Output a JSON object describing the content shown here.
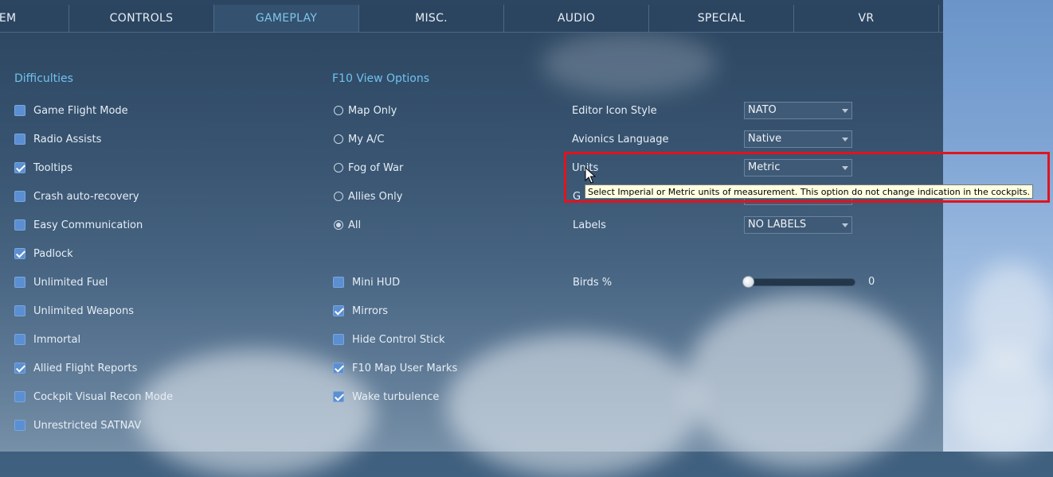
{
  "tabs": [
    {
      "label": "TEM"
    },
    {
      "label": "CONTROLS"
    },
    {
      "label": "GAMEPLAY"
    },
    {
      "label": "MISC."
    },
    {
      "label": "AUDIO"
    },
    {
      "label": "SPECIAL"
    },
    {
      "label": "VR"
    }
  ],
  "difficulties": {
    "title": "Difficulties",
    "items": [
      {
        "label": "Game Flight Mode",
        "checked": false
      },
      {
        "label": "Radio Assists",
        "checked": false
      },
      {
        "label": "Tooltips",
        "checked": true
      },
      {
        "label": "Crash auto-recovery",
        "checked": false
      },
      {
        "label": "Easy Communication",
        "checked": false
      },
      {
        "label": "Padlock",
        "checked": true
      },
      {
        "label": "Unlimited Fuel",
        "checked": false
      },
      {
        "label": "Unlimited Weapons",
        "checked": false
      },
      {
        "label": "Immortal",
        "checked": false
      },
      {
        "label": "Allied Flight Reports",
        "checked": true
      },
      {
        "label": "Cockpit Visual Recon Mode",
        "checked": false
      },
      {
        "label": "Unrestricted SATNAV",
        "checked": false
      }
    ]
  },
  "f10": {
    "title": "F10 View Options",
    "options": [
      {
        "label": "Map Only",
        "selected": false
      },
      {
        "label": "My A/C",
        "selected": false
      },
      {
        "label": "Fog of War",
        "selected": false
      },
      {
        "label": "Allies Only",
        "selected": false
      },
      {
        "label": "All",
        "selected": true
      }
    ]
  },
  "extras": {
    "items": [
      {
        "label": "Mini HUD",
        "checked": false
      },
      {
        "label": "Mirrors",
        "checked": true
      },
      {
        "label": "Hide Control Stick",
        "checked": false
      },
      {
        "label": "F10 Map User Marks",
        "checked": true
      },
      {
        "label": "Wake turbulence",
        "checked": true
      }
    ]
  },
  "settings": {
    "editor_icon_style": {
      "label": "Editor Icon Style",
      "value": "NATO"
    },
    "avionics_language": {
      "label": "Avionics Language",
      "value": "Native"
    },
    "units": {
      "label": "Units",
      "value": "Metric"
    },
    "hidden_row": {
      "label": "G"
    },
    "labels": {
      "label": "Labels",
      "value": "NO LABELS"
    },
    "birds": {
      "label": "Birds %",
      "value": "0",
      "fraction": 0
    }
  },
  "tooltip": {
    "text": "Select Imperial or Metric units of measurement. This option do not change indication in the cockpits."
  },
  "colors": {
    "accent": "#6fc2ee",
    "highlight": "#e0141e",
    "checkbox": "#5b8fd2"
  }
}
